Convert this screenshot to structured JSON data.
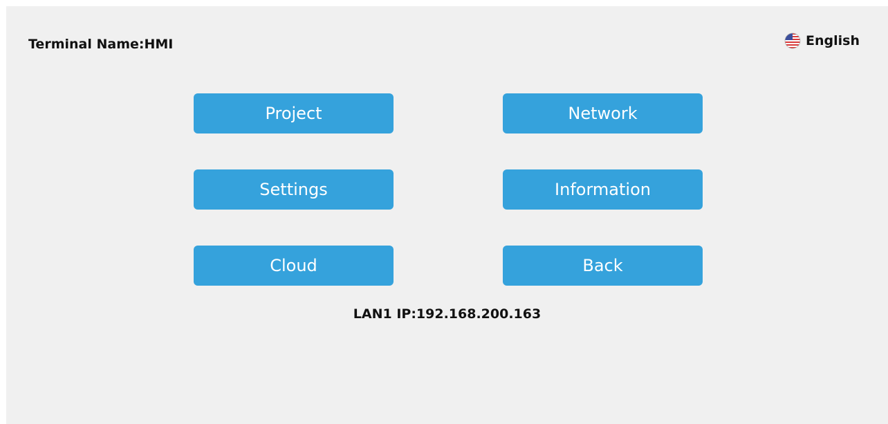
{
  "header": {
    "terminal_name": "Terminal Name:HMI",
    "language": {
      "label": "English",
      "icon": "us-flag-icon"
    }
  },
  "menu": {
    "project": "Project",
    "network": "Network",
    "settings": "Settings",
    "information": "Information",
    "cloud": "Cloud",
    "back": "Back"
  },
  "footer": {
    "ip": "LAN1 IP:192.168.200.163"
  },
  "colors": {
    "background": "#f0f0f0",
    "button": "#35a2dc",
    "button_text": "#ffffff",
    "text": "#111111"
  }
}
